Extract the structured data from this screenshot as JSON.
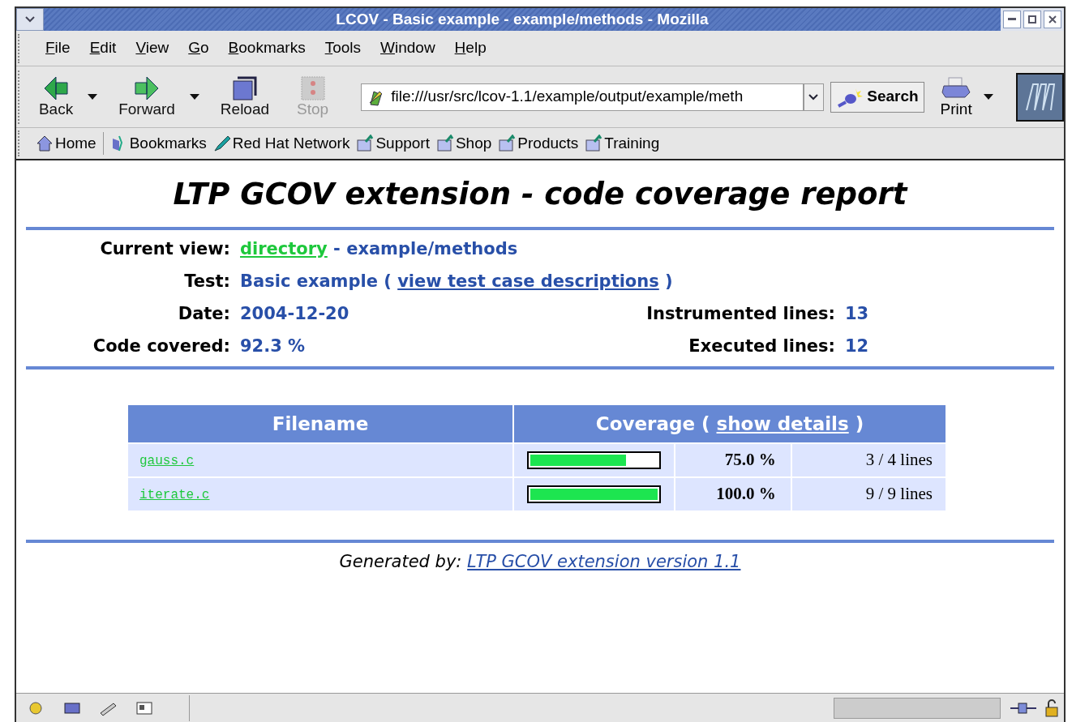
{
  "window": {
    "title": "LCOV - Basic example - example/methods - Mozilla"
  },
  "menu": [
    "File",
    "Edit",
    "View",
    "Go",
    "Bookmarks",
    "Tools",
    "Window",
    "Help"
  ],
  "toolbar": [
    {
      "kind": "back",
      "label": "Back",
      "disabled": false,
      "dropdown": true
    },
    {
      "kind": "forward",
      "label": "Forward",
      "disabled": false,
      "dropdown": true
    },
    {
      "kind": "reload",
      "label": "Reload",
      "disabled": false,
      "dropdown": false
    },
    {
      "kind": "stop",
      "label": "Stop",
      "disabled": true,
      "dropdown": false
    }
  ],
  "address": {
    "value": "file:///usr/src/lcov-1.1/example/output/example/meth"
  },
  "search_button": "Search",
  "print_button": "Print",
  "bookmarks_bar": [
    {
      "kind": "home",
      "label": "Home"
    },
    {
      "kind": "bookmarks",
      "label": "Bookmarks"
    },
    {
      "kind": "network",
      "label": "Red Hat Network"
    },
    {
      "kind": "folder",
      "label": "Support"
    },
    {
      "kind": "folder",
      "label": "Shop"
    },
    {
      "kind": "folder",
      "label": "Products"
    },
    {
      "kind": "folder",
      "label": "Training"
    }
  ],
  "page": {
    "title": "LTP GCOV extension - code coverage report",
    "info": [
      {
        "label": "Current view:",
        "link": "directory",
        "after": " - example/methods"
      },
      {
        "label": "Test:",
        "before": "Basic example ( ",
        "link": "view test case descriptions",
        "after": " )"
      },
      {
        "label": "Date:",
        "before": "2004-12-20",
        "right_label": "Instrumented lines:",
        "right_value": "13"
      },
      {
        "label": "Code covered:",
        "before": "92.3 %",
        "right_label": "Executed lines:",
        "right_value": "12"
      }
    ],
    "table": {
      "columns": [
        {
          "before": "Filename"
        },
        {
          "before": "Coverage ( ",
          "link": "show details",
          "after": " )"
        }
      ],
      "rows": [
        {
          "filename": "gauss.c",
          "level": 0.75,
          "percent": "75.0 %",
          "lines": "3 / 4 lines"
        },
        {
          "filename": "iterate.c",
          "level": 1.0,
          "percent": "100.0 %",
          "lines": "9 / 9 lines"
        }
      ]
    },
    "footer": {
      "before": "Generated by: ",
      "link": "LTP GCOV extension version 1.1"
    }
  }
}
